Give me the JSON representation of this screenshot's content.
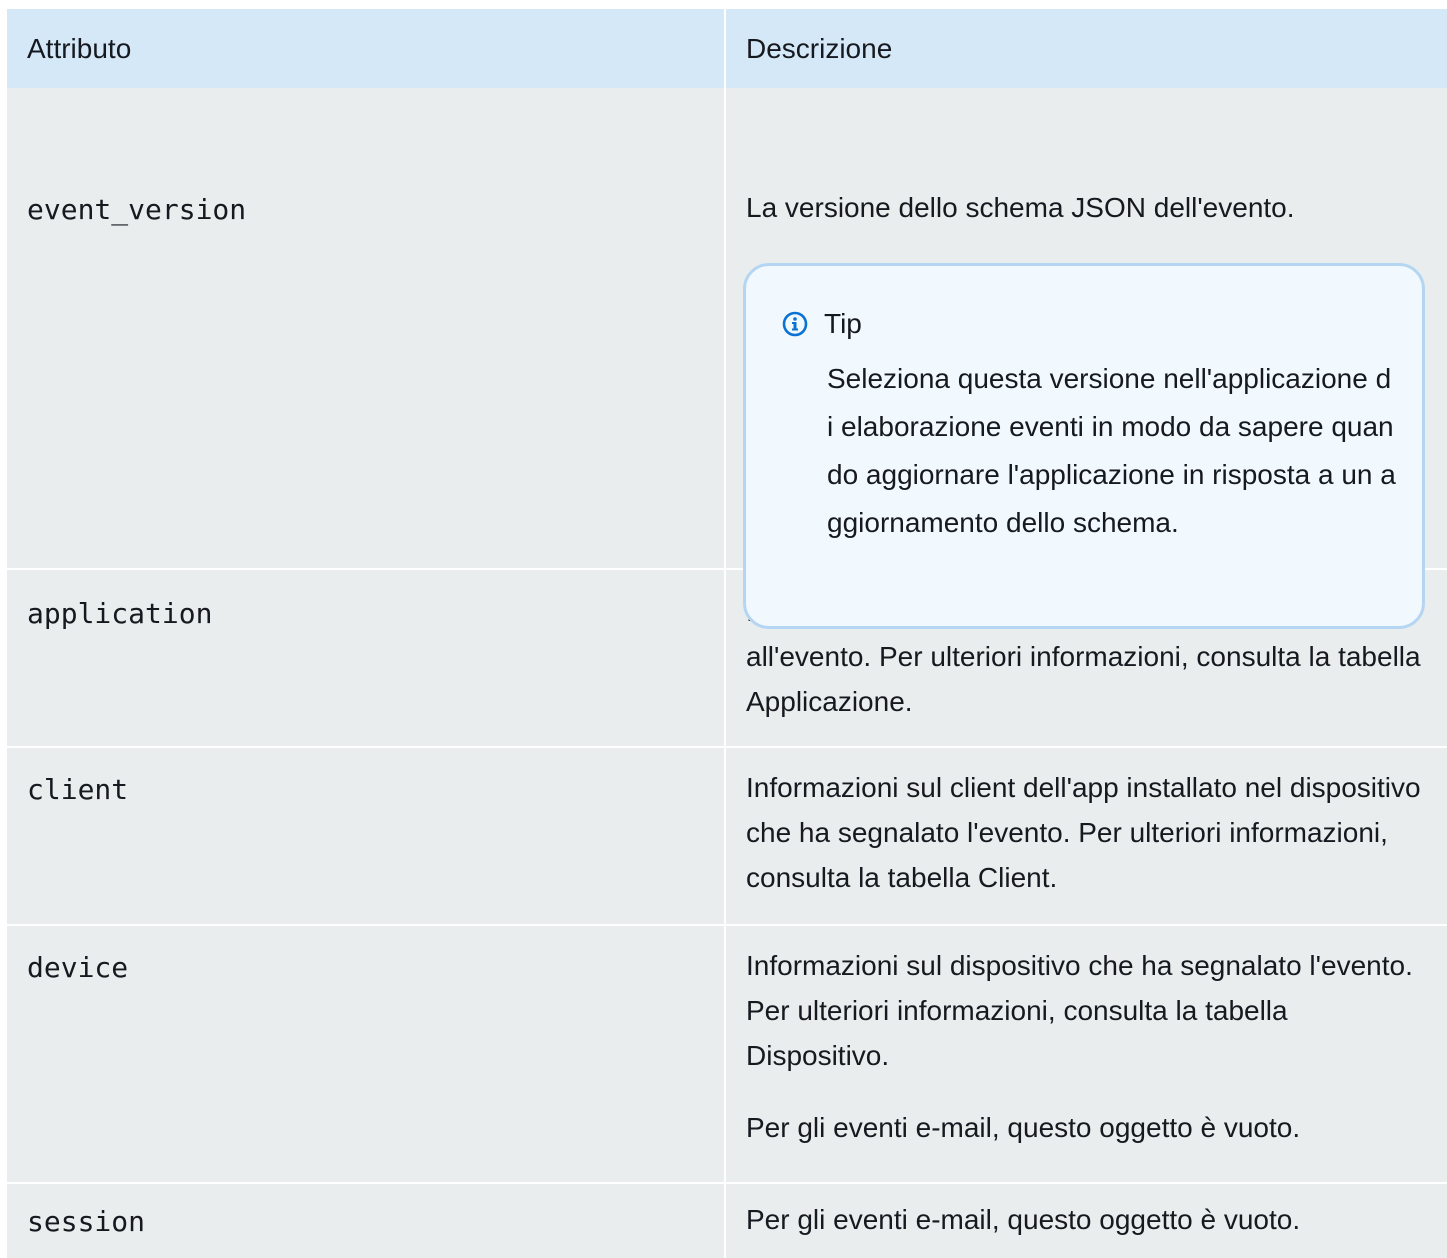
{
  "header": {
    "col1": "Attributo",
    "col2": "Descrizione"
  },
  "rows": [
    {
      "attr": "event_version",
      "desc": [
        "La versione dello schema JSON dell'evento."
      ],
      "tip": {
        "title": "Tip",
        "icon": "info-icon",
        "text": "Seleziona questa versione nell'applicazione di elaborazione eventi in modo da sapere quando aggiornare l'applicazione in risposta a un aggiornamento dello schema."
      }
    },
    {
      "attr": "application",
      "desc": [
        "Informazioni sul progetto Amazon Pinpoint associato all'evento. Per ulteriori informazioni, consulta la tabella Applicazione."
      ]
    },
    {
      "attr": "client",
      "desc": [
        "Informazioni sul client dell'app installato nel dispositivo che ha segnalato l'evento. Per ulteriori informazioni, consulta la tabella Client."
      ]
    },
    {
      "attr": "device",
      "desc": [
        "Informazioni sul dispositivo che ha segnalato l'evento. Per ulteriori informazioni, consulta la tabella Dispositivo.",
        "Per gli eventi e-mail, questo oggetto è vuoto."
      ]
    },
    {
      "attr": "session",
      "desc": [
        "Per gli eventi e-mail, questo oggetto è vuoto."
      ]
    }
  ]
}
